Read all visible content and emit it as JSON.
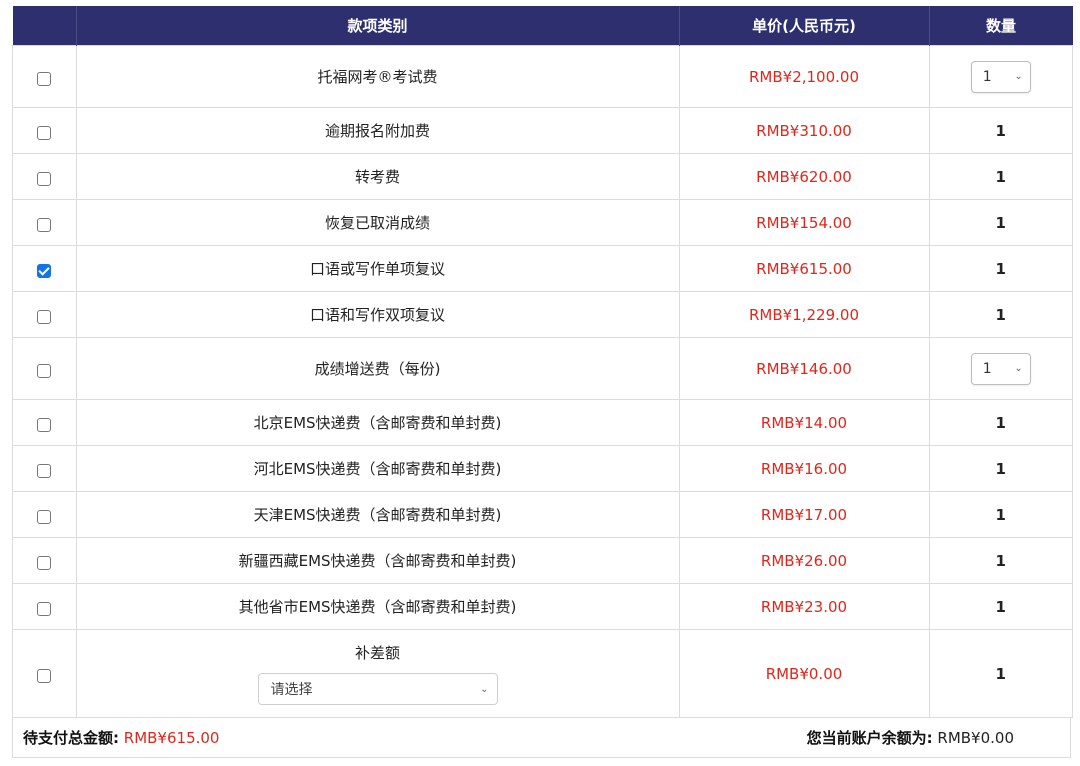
{
  "header": {
    "col_category": "款项类别",
    "col_price": "单价(人民币元)",
    "col_qty": "数量"
  },
  "rows": [
    {
      "name": "托福网考®考试费",
      "price": "RMB¥2,100.00",
      "qty": "1",
      "qty_type": "select",
      "checked": false
    },
    {
      "name": "逾期报名附加费",
      "price": "RMB¥310.00",
      "qty": "1",
      "qty_type": "text",
      "checked": false
    },
    {
      "name": "转考费",
      "price": "RMB¥620.00",
      "qty": "1",
      "qty_type": "text",
      "checked": false
    },
    {
      "name": "恢复已取消成绩",
      "price": "RMB¥154.00",
      "qty": "1",
      "qty_type": "text",
      "checked": false
    },
    {
      "name": "口语或写作单项复议",
      "price": "RMB¥615.00",
      "qty": "1",
      "qty_type": "text",
      "checked": true
    },
    {
      "name": "口语和写作双项复议",
      "price": "RMB¥1,229.00",
      "qty": "1",
      "qty_type": "text",
      "checked": false
    },
    {
      "name": "成绩增送费（每份)",
      "price": "RMB¥146.00",
      "qty": "1",
      "qty_type": "select",
      "checked": false
    },
    {
      "name": "北京EMS快递费（含邮寄费和单封费)",
      "price": "RMB¥14.00",
      "qty": "1",
      "qty_type": "text",
      "checked": false
    },
    {
      "name": "河北EMS快递费（含邮寄费和单封费)",
      "price": "RMB¥16.00",
      "qty": "1",
      "qty_type": "text",
      "checked": false
    },
    {
      "name": "天津EMS快递费（含邮寄费和单封费)",
      "price": "RMB¥17.00",
      "qty": "1",
      "qty_type": "text",
      "checked": false
    },
    {
      "name": "新疆西藏EMS快递费（含邮寄费和单封费)",
      "price": "RMB¥26.00",
      "qty": "1",
      "qty_type": "text",
      "checked": false
    },
    {
      "name": "其他省市EMS快递费（含邮寄费和单封费)",
      "price": "RMB¥23.00",
      "qty": "1",
      "qty_type": "text",
      "checked": false
    }
  ],
  "difference_row": {
    "name": "补差额",
    "select_value": "请选择",
    "price": "RMB¥0.00",
    "qty": "1",
    "checked": false
  },
  "footer": {
    "total_label": "待支付总金额:",
    "total_value": "RMB¥615.00",
    "balance_label": "您当前账户余额为:",
    "balance_value": "RMB¥0.00"
  },
  "colors": {
    "header_bg": "#2e2f6f",
    "price_red": "#e0261b",
    "checkbox_checked": "#1473e6"
  }
}
